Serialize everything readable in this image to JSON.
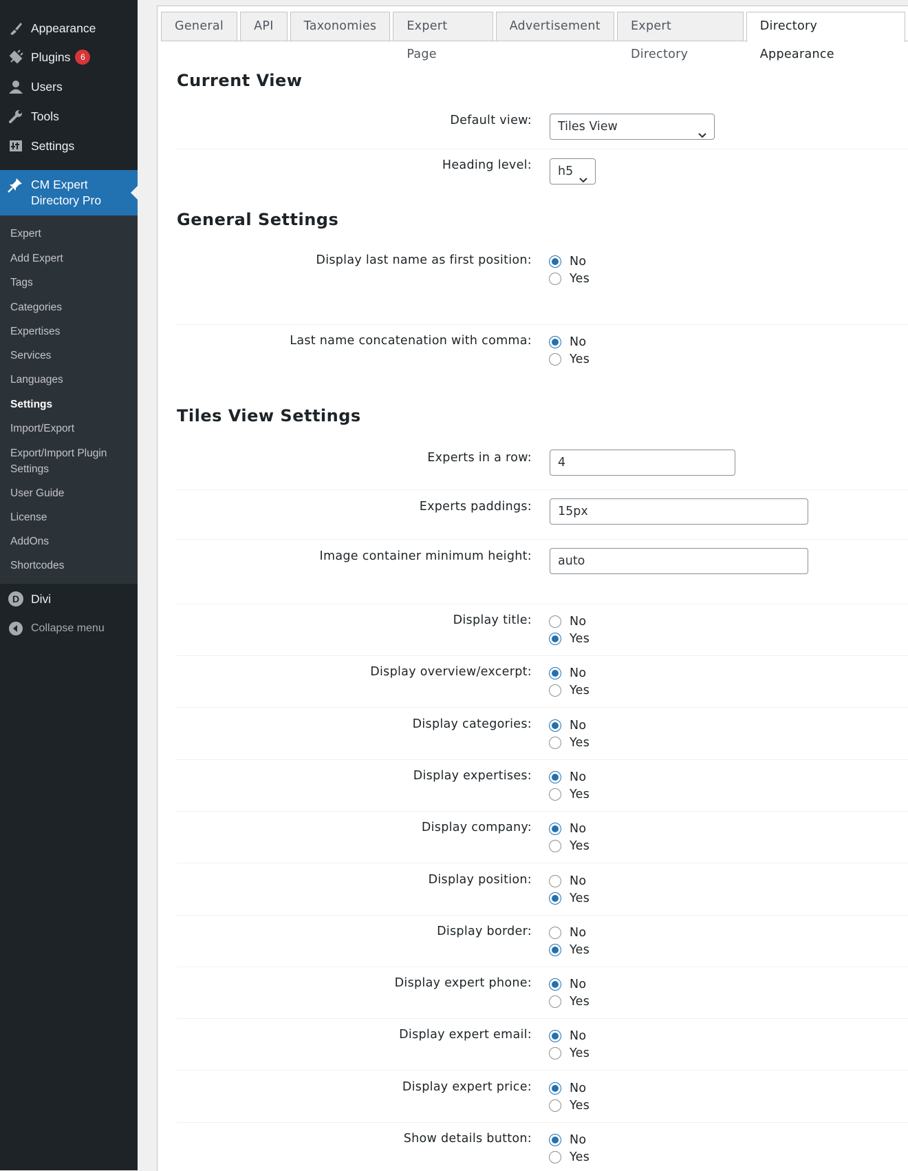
{
  "sidebar": {
    "top_items": [
      {
        "label": "Appearance",
        "icon": "paintbrush-icon"
      },
      {
        "label": "Plugins",
        "icon": "plugin-icon",
        "badge": "6"
      },
      {
        "label": "Users",
        "icon": "user-icon"
      },
      {
        "label": "Tools",
        "icon": "wrench-icon"
      },
      {
        "label": "Settings",
        "icon": "settings-icon"
      }
    ],
    "active": {
      "label": "CM Expert Directory Pro",
      "icon": "pin-icon"
    },
    "submenu": [
      "Expert",
      "Add Expert",
      "Tags",
      "Categories",
      "Expertises",
      "Services",
      "Languages",
      "Settings",
      "Import/Export",
      "Export/Import Plugin Settings",
      "User Guide",
      "License",
      "AddOns",
      "Shortcodes"
    ],
    "current_submenu": "Settings",
    "divi": {
      "label": "Divi",
      "icon_letter": "D"
    },
    "collapse": "Collapse menu"
  },
  "tabs": [
    "General",
    "API",
    "Taxonomies",
    "Expert Page",
    "Advertisement",
    "Expert Directory",
    "Directory Appearance"
  ],
  "active_tab": "Directory Appearance",
  "sections": {
    "current_view": "Current View",
    "general_settings": "General Settings",
    "tiles_view": "Tiles View Settings"
  },
  "fields": {
    "default_view": {
      "label": "Default view:",
      "value": "Tiles View"
    },
    "heading_level": {
      "label": "Heading level:",
      "value": "h5"
    },
    "last_name_first": {
      "label": "Display last name as first position:",
      "selected": "No"
    },
    "last_name_comma": {
      "label": "Last name concatenation with comma:",
      "selected": "No"
    },
    "experts_in_row": {
      "label": "Experts in a row:",
      "value": "4"
    },
    "experts_paddings": {
      "label": "Experts paddings:",
      "value": "15px"
    },
    "image_min_height": {
      "label": "Image container minimum height:",
      "value": "auto"
    }
  },
  "radio_options": {
    "no": "No",
    "yes": "Yes"
  },
  "toggles": [
    {
      "label": "Display title:",
      "selected": "Yes"
    },
    {
      "label": "Display overview/excerpt:",
      "selected": "No"
    },
    {
      "label": "Display categories:",
      "selected": "No"
    },
    {
      "label": "Display expertises:",
      "selected": "No"
    },
    {
      "label": "Display company:",
      "selected": "No"
    },
    {
      "label": "Display position:",
      "selected": "Yes"
    },
    {
      "label": "Display border:",
      "selected": "Yes"
    },
    {
      "label": "Display expert phone:",
      "selected": "No"
    },
    {
      "label": "Display expert email:",
      "selected": "No"
    },
    {
      "label": "Display expert price:",
      "selected": "No"
    },
    {
      "label": "Show details button:",
      "selected": "No"
    }
  ],
  "colors": {
    "sidebar_bg": "#1d2327",
    "submenu_bg": "#2c3338",
    "accent": "#2271b1",
    "badge": "#d63638"
  }
}
